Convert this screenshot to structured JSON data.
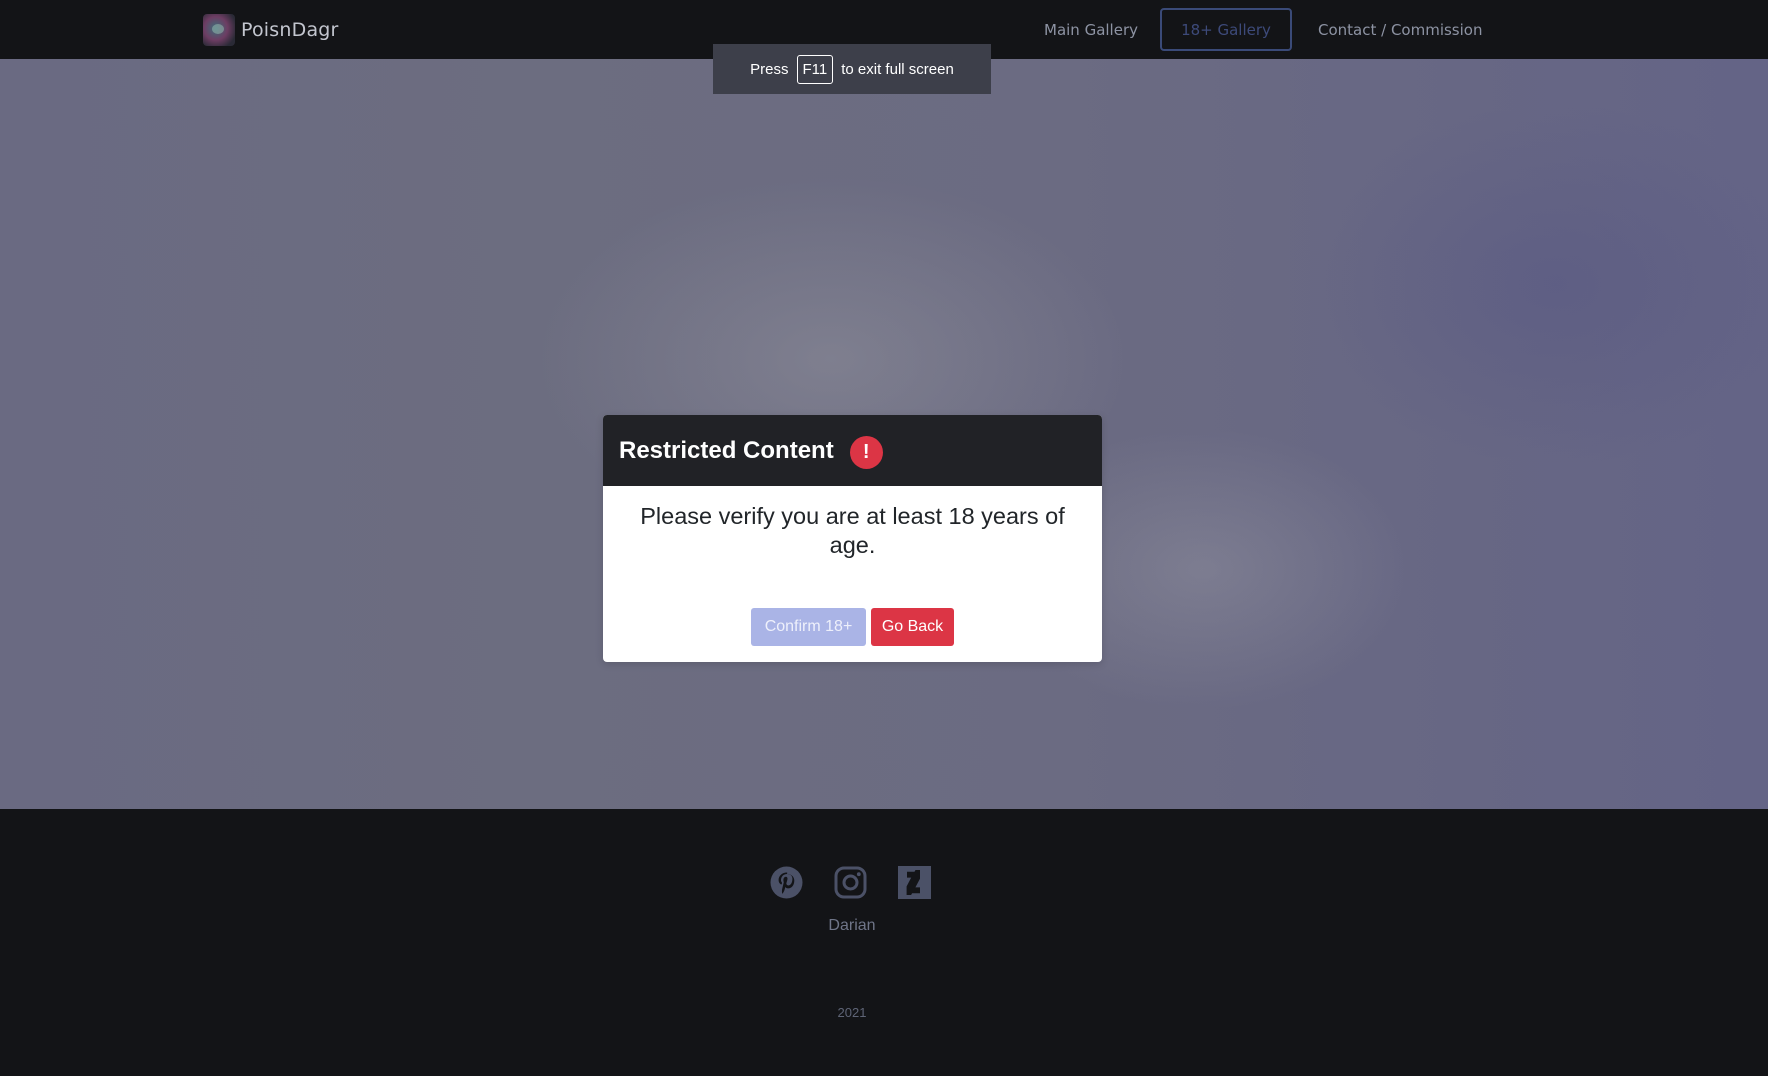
{
  "navbar": {
    "brand": "PoisnDagr",
    "links": [
      "Main Gallery",
      "18+ Gallery",
      "Contact / Commission"
    ],
    "active_link": "18+ Gallery"
  },
  "fullscreen_toast": {
    "prefix": "Press",
    "key": "F11",
    "suffix": "to exit full screen"
  },
  "modal": {
    "title": "Restricted Content",
    "warning_icon": "exclamation-circle-icon",
    "warning_glyph": "!",
    "message": "Please verify you are at least 18 years of age.",
    "confirm_label": "Confirm 18+",
    "back_label": "Go Back"
  },
  "footer": {
    "social_icons": [
      "pinterest-icon",
      "instagram-icon",
      "deviantart-icon"
    ],
    "name": "Darian",
    "year": "2021"
  },
  "colors": {
    "danger": "#dc3545",
    "confirm": "#aab4e6",
    "dark": "#131417",
    "modal_header": "#212226"
  }
}
